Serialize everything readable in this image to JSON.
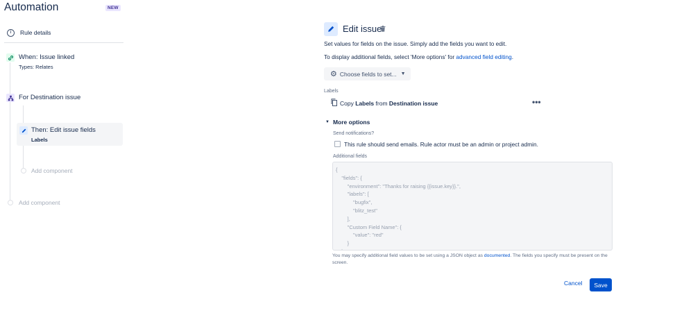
{
  "app": {
    "title": "Automation",
    "badge": "NEW"
  },
  "sidebar": {
    "rule_details": "Rule details",
    "trigger": {
      "title": "When: Issue linked",
      "subtitle": "Types: Relates"
    },
    "branch": {
      "title": "For Destination issue"
    },
    "action": {
      "title": "Then: Edit issue fields",
      "subtitle": "Labels"
    },
    "add_component_inner": "Add component",
    "add_component_outer": "Add component"
  },
  "panel": {
    "title": "Edit issue",
    "description_1": "Set values for fields on the issue. Simply add the fields you want to edit.",
    "description_2_prefix": "To display additional fields, select 'More options' for",
    "description_2_link": "advanced field editing",
    "description_2_suffix": ".",
    "choose_fields_button": "Choose fields to set...",
    "labels_field_label": "Labels",
    "copy_row": {
      "prefix": "Copy",
      "field": "Labels",
      "middle": "from",
      "source": "Destination issue"
    },
    "more_options": "More options",
    "send_notifications_label": "Send notifications?",
    "send_notifications_checkbox": "This rule should send emails. Rule actor must be an admin or project admin.",
    "send_notifications_checked": false,
    "additional_fields_label": "Additional fields",
    "additional_fields_placeholder": "{\n    \"fields\": {\n        \"environment\": \"Thanks for raising {{issue.key}}.\",\n        \"labels\": [\n            \"bugfix\",\n            \"blitz_test\"\n        ],\n        \"Custom Field Name\": {\n            \"value\": \"red\"\n        }\n    }\n}",
    "help_prefix": "You may specify additional field values to be set using a JSON object as",
    "help_link": "documented",
    "help_suffix": ". The fields you specify must be present on the screen.",
    "cancel": "Cancel",
    "save": "Save"
  },
  "colors": {
    "primary": "#0052cc",
    "trigger_green": "#00875a",
    "branch_purple": "#403294"
  }
}
